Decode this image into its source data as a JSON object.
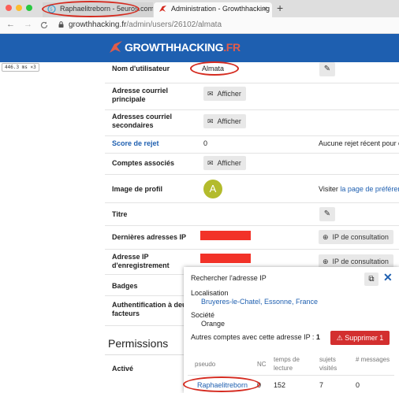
{
  "browser": {
    "tabs": [
      {
        "label": "Raphaelitreborn - 5euros.com",
        "close": "×"
      },
      {
        "label": "Administration - Growthhacking",
        "close": "×"
      }
    ],
    "new_tab": "+",
    "url_host": "growthhacking.fr",
    "url_path": "/admin/users/26102/almata",
    "back": "←",
    "forward": "→",
    "reload": "C"
  },
  "brand": {
    "name": "GROWTHHACKING",
    "suffix": ".FR"
  },
  "perf_badge": "446.3 ms ×3",
  "fields": {
    "username_label": "Nom d'utilisateur",
    "username_value": "Almata",
    "email_primary_label": "Adresse courriel principale",
    "email_secondary_label": "Adresses courriel secondaires",
    "show_label": "Afficher",
    "reject_score_label": "Score de rejet",
    "reject_score_value": "0",
    "reject_note": "Aucune rejet récent pour c",
    "linked_accounts_label": "Comptes associés",
    "profile_image_label": "Image de profil",
    "avatar_letter": "A",
    "visit_text": "Visiter ",
    "visit_link": "la page de préféren",
    "title_label": "Titre",
    "last_ip_label": "Dernières adresses IP",
    "ip_lookup_label": "IP de consultation",
    "reg_ip_label": "Adresse IP d'enregistrement",
    "badges_label": "Badges",
    "twofa_label": "Authentification à deux facteurs",
    "permissions_heading": "Permissions",
    "active_label": "Activé"
  },
  "popup": {
    "title": "Rechercher l'adresse IP",
    "location_label": "Localisation",
    "location_value": "Bruyeres-le-Chatel, Essonne, France",
    "company_label": "Société",
    "company_value": "Orange",
    "other_accounts_label": "Autres comptes avec cette adresse IP : ",
    "other_accounts_count": "1",
    "delete_label": "Supprimer 1",
    "columns": [
      "pseudo",
      "NC",
      "temps de lecture",
      "sujets visités",
      "# messages"
    ],
    "row": {
      "pseudo": "Raphaelitreborn",
      "nc": "0",
      "reading_time": "152",
      "topics": "7",
      "messages": "0"
    }
  },
  "colors": {
    "brand_blue": "#1e5fb0",
    "accent_red": "#d52b20",
    "redacted": "#f23228",
    "avatar": "#b3bb2c"
  }
}
